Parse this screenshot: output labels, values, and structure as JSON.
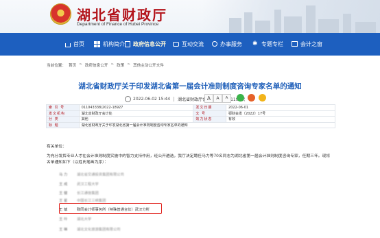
{
  "header": {
    "site_name": "湖北省财政厅",
    "site_subtitle": "Department of Finance of Hubei Province"
  },
  "nav": {
    "items": [
      {
        "label": "首页",
        "icon": "home-icon"
      },
      {
        "label": "机构简介",
        "icon": "grid-icon"
      },
      {
        "label": "政府信息公开",
        "icon": "doc-icon",
        "active": true
      },
      {
        "label": "互动交流",
        "icon": "chat-icon"
      },
      {
        "label": "办事服务",
        "icon": "user-icon"
      },
      {
        "label": "专题专栏",
        "icon": "star-icon"
      },
      {
        "label": "会计之窗",
        "icon": "book-icon"
      }
    ]
  },
  "breadcrumb": {
    "prefix": "当前位置：",
    "items": [
      "首页",
      "政府信息公开",
      "政策",
      "其他主动公开文件"
    ]
  },
  "article": {
    "title": "湖北省财政厅关于印发湖北省第一届会计准则制度咨询专家名单的通知",
    "date": "2022-06-02 15:44",
    "source": "湖北省财政厅会计处",
    "views": "1193次",
    "font_sizes": [
      "A",
      "A",
      "A"
    ]
  },
  "info_table": {
    "rows": [
      {
        "k1": "索  引  号",
        "v1": "011043338/2022-18927",
        "k2": "发文日期",
        "v2": "2022-06-01"
      },
      {
        "k1": "发文机构",
        "v1": "湖北省财政厅会计处",
        "k2": "文    号",
        "v2": "鄂财会发〔2022〕17号"
      },
      {
        "k1": "分    类",
        "v1": "其他",
        "k2": "效力状态",
        "v2": "有效"
      },
      {
        "k1": "标    题",
        "v1": "湖北省财政厅关于印发湖北省第一届会计准则制度咨询专家名单的通知",
        "k2": "",
        "v2": ""
      }
    ]
  },
  "body": {
    "greeting": "有关单位：",
    "paragraph": "为充分发挥专业人才在会计准则制度实施中的智力支持作用，经公开遴选，我厅决定聘任马力等70名同志为湖北省第一届会计准则制度咨询专家，任期三年。现将名单通知如下（以姓氏笔画为序）：",
    "list": [
      {
        "name": "马  力",
        "org": "湖北省交通投资集团有限公司"
      },
      {
        "name": "王  成",
        "org": "武汉工程大学"
      },
      {
        "name": "王  健",
        "org": "长江通信集团"
      },
      {
        "name": "王  星",
        "org": "中国长江三峡集团"
      },
      {
        "name": "王  斌",
        "org": "致同会计师事务所（特殊普通合伙）武汉分所"
      },
      {
        "name": "王  玲",
        "org": "湖北大学"
      },
      {
        "name": "王  琳",
        "org": "湖北文化旅游集团有限公司"
      }
    ]
  },
  "colors": {
    "brand_red": "#b3141b",
    "nav_blue": "#1d5fbf",
    "title_blue": "#1f5fb9",
    "highlight_red": "#e0201b"
  }
}
